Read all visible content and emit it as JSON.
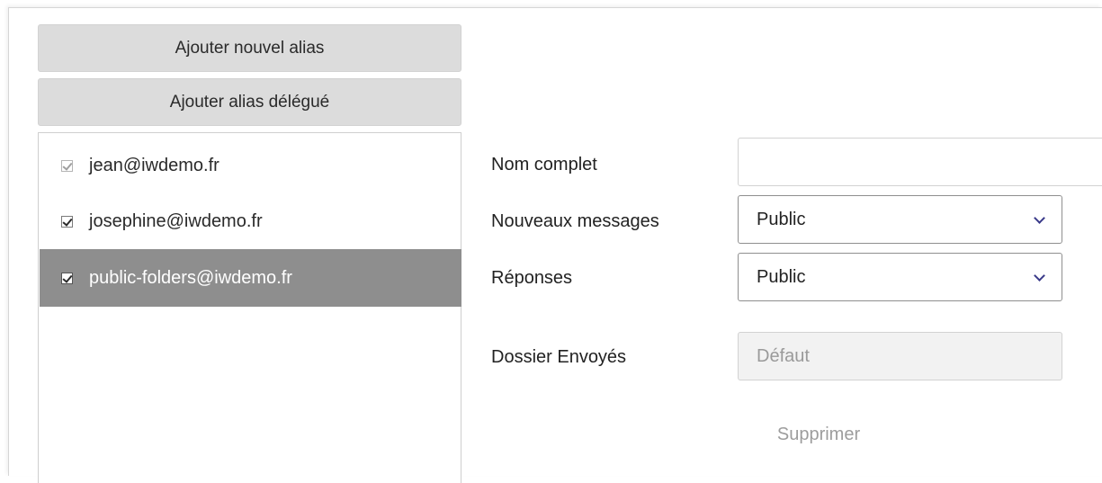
{
  "buttons": {
    "add_alias": "Ajouter nouvel alias",
    "add_delegated_alias": "Ajouter alias délégué",
    "delete": "Supprimer"
  },
  "aliases": [
    {
      "email": "jean@iwdemo.fr",
      "checked": true,
      "disabled": true,
      "selected": false
    },
    {
      "email": "josephine@iwdemo.fr",
      "checked": true,
      "disabled": false,
      "selected": false
    },
    {
      "email": "public-folders@iwdemo.fr",
      "checked": true,
      "disabled": false,
      "selected": true
    }
  ],
  "form": {
    "full_name_label": "Nom complet",
    "full_name_value": "",
    "new_messages_label": "Nouveaux messages",
    "new_messages_value": "Public",
    "replies_label": "Réponses",
    "replies_value": "Public",
    "sent_folder_label": "Dossier Envoyés",
    "sent_folder_value": "Défaut"
  },
  "colors": {
    "button_bg": "#dcdcdc",
    "selected_row_bg": "#8e8e8e",
    "chevron": "#3a3a8a"
  },
  "icons": {
    "checkbox": "checkbox-checked-icon",
    "dropdown": "chevron-down-icon"
  }
}
